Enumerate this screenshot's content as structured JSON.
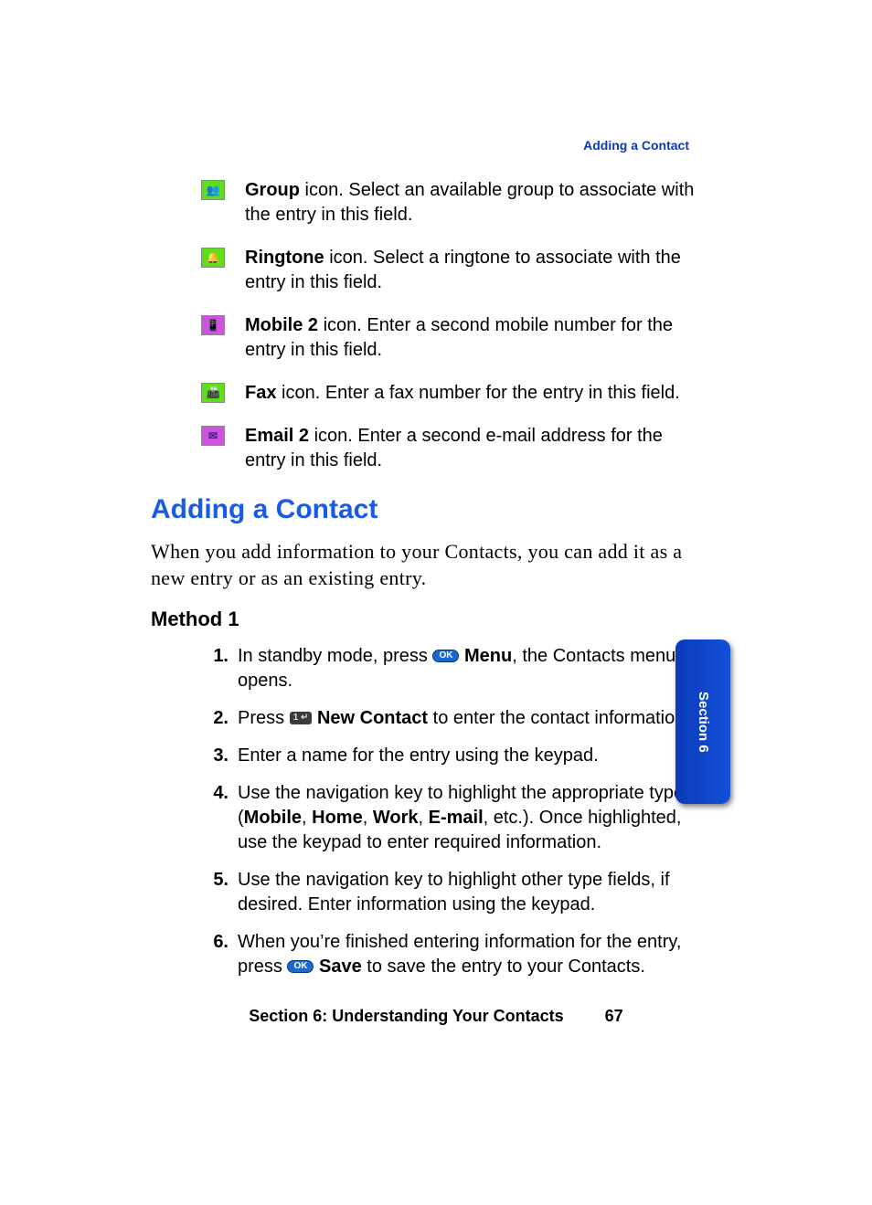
{
  "runningHead": "Adding a Contact",
  "iconRows": [
    {
      "iconName": "group-icon",
      "iconClass": "icon-green",
      "glyph": "👥",
      "bold": "Group",
      "rest": " icon. Select an available group to associate with the entry in this field."
    },
    {
      "iconName": "ringtone-icon",
      "iconClass": "icon-green",
      "glyph": "🔔",
      "bold": "Ringtone",
      "rest": " icon. Select a ringtone to associate with the entry in this field."
    },
    {
      "iconName": "mobile2-icon",
      "iconClass": "icon-purple",
      "glyph": "📱",
      "bold": "Mobile 2",
      "rest": " icon. Enter a second mobile number for the entry in this field."
    },
    {
      "iconName": "fax-icon",
      "iconClass": "icon-green",
      "glyph": "📠",
      "bold": "Fax",
      "rest": " icon. Enter a fax number for the entry in this field."
    },
    {
      "iconName": "email2-icon",
      "iconClass": "icon-purple",
      "glyph": "✉",
      "bold": "Email 2",
      "rest": " icon. Enter a second e-mail address for the entry in this field."
    }
  ],
  "sectionTitle": "Adding a Contact",
  "intro": "When you add information to your Contacts, you can add it as a new entry or as an existing entry.",
  "methodHeading": "Method 1",
  "okLabel": "OK",
  "keyLabel": "1 ↵",
  "steps": [
    {
      "n": "1.",
      "pre": "In standby mode, press ",
      "badge": "ok",
      "boldAfter": " Menu",
      "post": ", the Contacts menu opens."
    },
    {
      "n": "2.",
      "pre": "Press ",
      "badge": "key",
      "boldAfter": " New Contact",
      "post": " to enter the contact information."
    },
    {
      "n": "3.",
      "pre": "Enter a name for the entry using the keypad.",
      "badge": "",
      "boldAfter": "",
      "post": ""
    },
    {
      "n": "4.",
      "pre": "Use the navigation key to highlight the appropriate type (",
      "badge": "",
      "boldAfter": "",
      "post": "",
      "inlineBolds": [
        "Mobile",
        "Home",
        "Work",
        "E-mail"
      ],
      "tail": ", etc.). Once highlighted, use the keypad to enter required information."
    },
    {
      "n": "5.",
      "pre": "Use the navigation key to highlight other type fields, if desired. Enter information using the keypad.",
      "badge": "",
      "boldAfter": "",
      "post": ""
    },
    {
      "n": "6.",
      "pre": "When you’re finished entering information for the entry, press ",
      "badge": "ok",
      "boldAfter": " Save",
      "post": " to save the entry to your Contacts."
    }
  ],
  "sideTab": "Section 6",
  "footerSection": "Section 6: Understanding Your Contacts",
  "pageNumber": "67"
}
